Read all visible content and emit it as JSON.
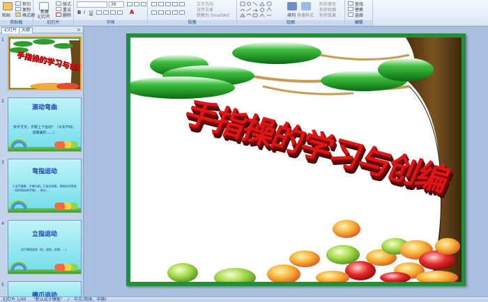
{
  "ribbon": {
    "clipboard": {
      "paste": "粘贴",
      "cut": "剪切",
      "copy": "复制",
      "format_painter": "格式刷",
      "label": "剪贴板"
    },
    "slides": {
      "new_slide": "新建",
      "new_slide_2": "幻灯片",
      "layout": "版式",
      "reset": "重设",
      "delete": "删除",
      "label": "幻灯片"
    },
    "font": {
      "size": "36",
      "label": "字体"
    },
    "paragraph": {
      "text_direction": "文字方向",
      "align_text": "对齐文本",
      "smartart": "转换为 SmartArt",
      "label": "段落"
    },
    "drawing": {
      "arrange": "排列",
      "quick_styles": "快速样式",
      "shape_fill": "形状填充",
      "shape_outline": "形状轮廓",
      "shape_effects": "形状效果",
      "label": "绘图"
    },
    "editing": {
      "find": "查找",
      "replace": "替换",
      "select": "选择",
      "label": "编辑"
    }
  },
  "pane": {
    "tab_slides": "幻灯片",
    "tab_outline": "大纲",
    "close": "×",
    "thumbs": [
      {
        "num": "1",
        "type": "title",
        "title": "手指操的学习与创编"
      },
      {
        "num": "2",
        "type": "cyan",
        "title": "滚动弯曲",
        "text": "双手交叉，手腕上下运动！（大车开动，道路曲折……）"
      },
      {
        "num": "3",
        "type": "cyan",
        "title": "弯指运动",
        "text": "1.双手握拳，手掌向前。2.依次伸直、食指向内弯曲（同时指向的手指）、依次…"
      },
      {
        "num": "4",
        "type": "cyan",
        "title": "立指运动",
        "text": "双手掌指张合（拍、敲指、抓物……）"
      },
      {
        "num": "5",
        "type": "cyan",
        "title": "摘爪运动",
        "text": ""
      }
    ]
  },
  "slide": {
    "title": "手指操的学习与创编"
  },
  "status": {
    "slide_count": "幻灯片 1/40",
    "theme": "\"默认设计模板\"",
    "language": "中文(简体，中国)"
  }
}
